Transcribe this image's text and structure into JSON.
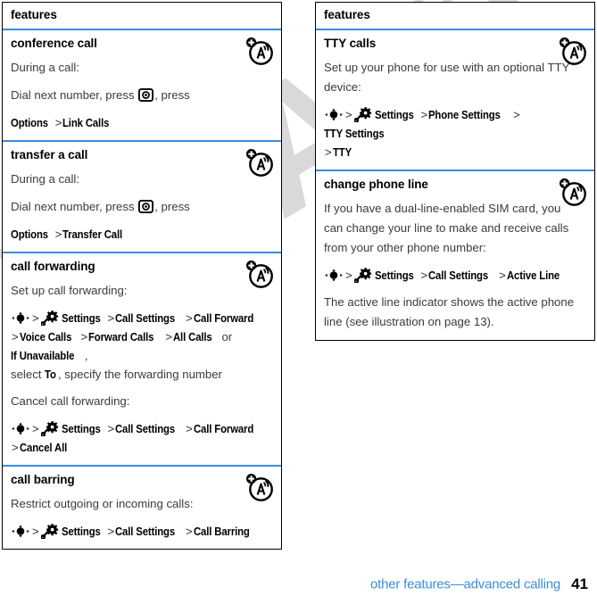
{
  "document": {
    "watermark": "DRAFT",
    "footer": {
      "chapter": "other features—advanced calling",
      "page_number": "41"
    },
    "accent_color": "#3a8ddb",
    "heading_color": "#000000",
    "body_color": "#3b3b3b"
  },
  "left_table": {
    "header": "features",
    "rows": [
      {
        "title": "conference call",
        "icon": "network-tower-icon",
        "blocks": [
          {
            "kind": "para",
            "text": "During a call:"
          },
          {
            "kind": "mixed",
            "parts": [
              {
                "t": "plain",
                "v": "Dial next number, press "
              },
              {
                "t": "key",
                "v": "center-key-icon"
              },
              {
                "t": "plain",
                "v": ", press"
              }
            ]
          },
          {
            "kind": "path",
            "parts": [
              {
                "t": "menu",
                "v": "Options"
              },
              {
                "t": "gt",
                "v": ">"
              },
              {
                "t": "menu",
                "v": "Link Calls"
              }
            ]
          }
        ]
      },
      {
        "title": "transfer a call",
        "icon": "network-tower-icon",
        "blocks": [
          {
            "kind": "para",
            "text": "During a call:"
          },
          {
            "kind": "mixed",
            "parts": [
              {
                "t": "plain",
                "v": "Dial next number, press "
              },
              {
                "t": "key",
                "v": "center-key-icon"
              },
              {
                "t": "plain",
                "v": ", press"
              }
            ]
          },
          {
            "kind": "path",
            "parts": [
              {
                "t": "menu",
                "v": "Options"
              },
              {
                "t": "gt",
                "v": ">"
              },
              {
                "t": "menu",
                "v": "Transfer Call"
              }
            ]
          }
        ]
      },
      {
        "title": "call forwarding",
        "icon": "network-tower-icon",
        "blocks": [
          {
            "kind": "para",
            "text": "Set up call forwarding:"
          },
          {
            "kind": "path",
            "parts": [
              {
                "t": "nav",
                "v": "navigation-key-icon"
              },
              {
                "t": "gt",
                "v": ">"
              },
              {
                "t": "gear",
                "v": "settings-gear-icon"
              },
              {
                "t": "menu",
                "v": "Settings"
              },
              {
                "t": "gt",
                "v": ">"
              },
              {
                "t": "menu",
                "v": "Call Settings"
              },
              {
                "t": "gt",
                "v": ">"
              },
              {
                "t": "menu",
                "v": "Call Forward"
              },
              {
                "t": "br",
                "v": ""
              },
              {
                "t": "gt",
                "v": ">"
              },
              {
                "t": "menu",
                "v": "Voice Calls"
              },
              {
                "t": "gt",
                "v": ">"
              },
              {
                "t": "menu",
                "v": "Forward Calls"
              },
              {
                "t": "gt",
                "v": ">"
              },
              {
                "t": "menu",
                "v": "All Calls"
              },
              {
                "t": "plain",
                "v": " or "
              },
              {
                "t": "menu",
                "v": "If Unavailable"
              },
              {
                "t": "plain",
                "v": ","
              },
              {
                "t": "br",
                "v": ""
              },
              {
                "t": "plain",
                "v": "select "
              },
              {
                "t": "menu",
                "v": "To"
              },
              {
                "t": "plain",
                "v": ", specify the forwarding number"
              }
            ]
          },
          {
            "kind": "para",
            "text": "Cancel call forwarding:"
          },
          {
            "kind": "path",
            "parts": [
              {
                "t": "nav",
                "v": "navigation-key-icon"
              },
              {
                "t": "gt",
                "v": ">"
              },
              {
                "t": "gear",
                "v": "settings-gear-icon"
              },
              {
                "t": "menu",
                "v": "Settings"
              },
              {
                "t": "gt",
                "v": ">"
              },
              {
                "t": "menu",
                "v": "Call Settings"
              },
              {
                "t": "gt",
                "v": ">"
              },
              {
                "t": "menu",
                "v": "Call Forward"
              },
              {
                "t": "br",
                "v": ""
              },
              {
                "t": "gt",
                "v": ">"
              },
              {
                "t": "menu",
                "v": "Cancel All"
              }
            ]
          }
        ]
      },
      {
        "title": "call barring",
        "icon": "network-tower-icon",
        "blocks": [
          {
            "kind": "para",
            "text": "Restrict outgoing or incoming calls:"
          },
          {
            "kind": "path",
            "parts": [
              {
                "t": "nav",
                "v": "navigation-key-icon"
              },
              {
                "t": "gt",
                "v": ">"
              },
              {
                "t": "gear",
                "v": "settings-gear-icon"
              },
              {
                "t": "menu",
                "v": "Settings"
              },
              {
                "t": "gt",
                "v": ">"
              },
              {
                "t": "menu",
                "v": "Call Settings"
              },
              {
                "t": "gt",
                "v": ">"
              },
              {
                "t": "menu",
                "v": "Call Barring"
              }
            ]
          }
        ]
      }
    ]
  },
  "right_table": {
    "header": "features",
    "rows": [
      {
        "title": "TTY calls",
        "icon": "network-tower-icon",
        "blocks": [
          {
            "kind": "para",
            "text": "Set up your phone for use with an optional TTY device:"
          },
          {
            "kind": "path",
            "parts": [
              {
                "t": "nav",
                "v": "navigation-key-icon"
              },
              {
                "t": "gt",
                "v": ">"
              },
              {
                "t": "gear",
                "v": "settings-gear-icon"
              },
              {
                "t": "menu",
                "v": "Settings"
              },
              {
                "t": "gt",
                "v": ">"
              },
              {
                "t": "menu",
                "v": "Phone Settings"
              },
              {
                "t": "gt",
                "v": ">"
              },
              {
                "t": "menu",
                "v": "TTY Settings"
              },
              {
                "t": "br",
                "v": ""
              },
              {
                "t": "gt",
                "v": ">"
              },
              {
                "t": "menu",
                "v": "TTY"
              }
            ]
          }
        ]
      },
      {
        "title": "change phone line",
        "icon": "network-tower-icon",
        "blocks": [
          {
            "kind": "para",
            "text": "If you have a dual-line-enabled SIM card, you can change your line to make and receive calls from your other phone number:"
          },
          {
            "kind": "path",
            "parts": [
              {
                "t": "nav",
                "v": "navigation-key-icon"
              },
              {
                "t": "gt",
                "v": ">"
              },
              {
                "t": "gear",
                "v": "settings-gear-icon"
              },
              {
                "t": "menu",
                "v": "Settings"
              },
              {
                "t": "gt",
                "v": ">"
              },
              {
                "t": "menu",
                "v": "Call Settings"
              },
              {
                "t": "gt",
                "v": ">"
              },
              {
                "t": "menu",
                "v": "Active Line"
              }
            ]
          },
          {
            "kind": "para",
            "text": "The active line indicator shows the active phone line (see illustration on page 13)."
          }
        ]
      }
    ]
  }
}
